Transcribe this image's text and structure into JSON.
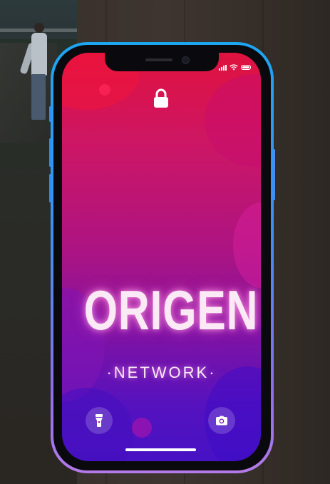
{
  "app": {
    "title": ""
  },
  "lockscreen": {
    "logo": {
      "word": "ORIGEN",
      "sub": "·NETWORK·"
    },
    "lock_icon": "lock-icon",
    "quick_actions": [
      {
        "icon": "flashlight-icon"
      },
      {
        "icon": "camera-icon"
      }
    ],
    "status_icons": [
      "signal-icon",
      "wifi-icon",
      "battery-icon"
    ]
  },
  "colors": {
    "frame_top": "#1da6f0",
    "frame_bottom": "#b47ae8",
    "screen_top": "#e0123e",
    "screen_bottom": "#4612c4",
    "logo_text": "#fbeaf6"
  }
}
